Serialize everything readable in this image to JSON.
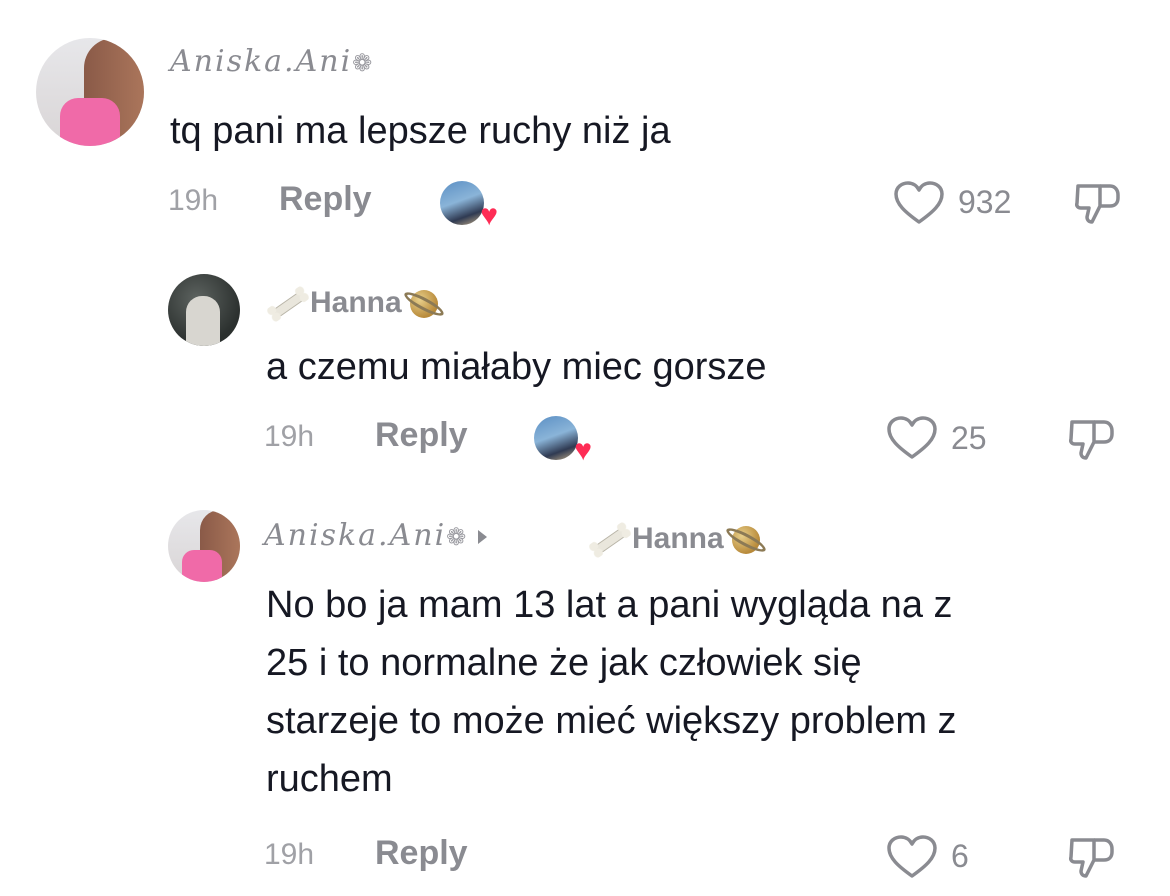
{
  "comments": [
    {
      "username": "Aniska.Ani",
      "username_icon": "flower-icon",
      "text": "tq pani ma lepsze ruchy niż ja",
      "time": "19h",
      "reply_label": "Reply",
      "likes": "932"
    },
    {
      "username": "Hanna",
      "username_icons": [
        "bone-icon",
        "planet-icon"
      ],
      "text": "a czemu miałaby miec gorsze",
      "time": "19h",
      "reply_label": "Reply",
      "likes": "25"
    },
    {
      "username": "Aniska.Ani",
      "reply_to": "Hanna",
      "text_lines": [
        "No bo ja mam 13 lat a pani wygląda na z",
        "25 i to normalne że jak człowiek się",
        "starzeje to może mieć większy problem z",
        "ruchem"
      ],
      "time": "19h",
      "reply_label": "Reply",
      "likes": "6"
    }
  ],
  "colors": {
    "text": "#161823",
    "muted": "#8a8b91",
    "heart": "#fe2c55"
  }
}
